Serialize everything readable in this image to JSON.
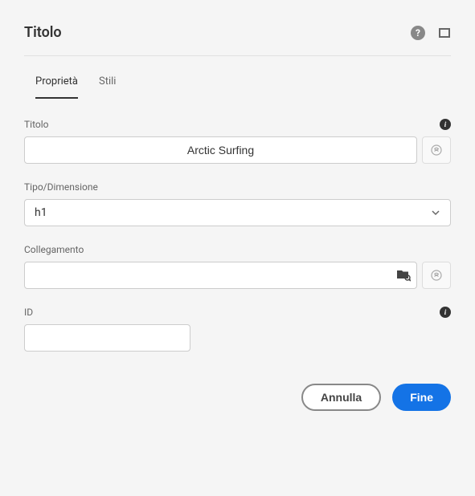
{
  "header": {
    "title": "Titolo"
  },
  "tabs": {
    "properties": "Proprietà",
    "styles": "Stili"
  },
  "fields": {
    "title": {
      "label": "Titolo",
      "value": "Arctic Surfing"
    },
    "type": {
      "label": "Tipo/Dimensione",
      "value": "h1"
    },
    "link": {
      "label": "Collegamento",
      "value": ""
    },
    "id": {
      "label": "ID",
      "value": ""
    }
  },
  "footer": {
    "cancel": "Annulla",
    "done": "Fine"
  }
}
